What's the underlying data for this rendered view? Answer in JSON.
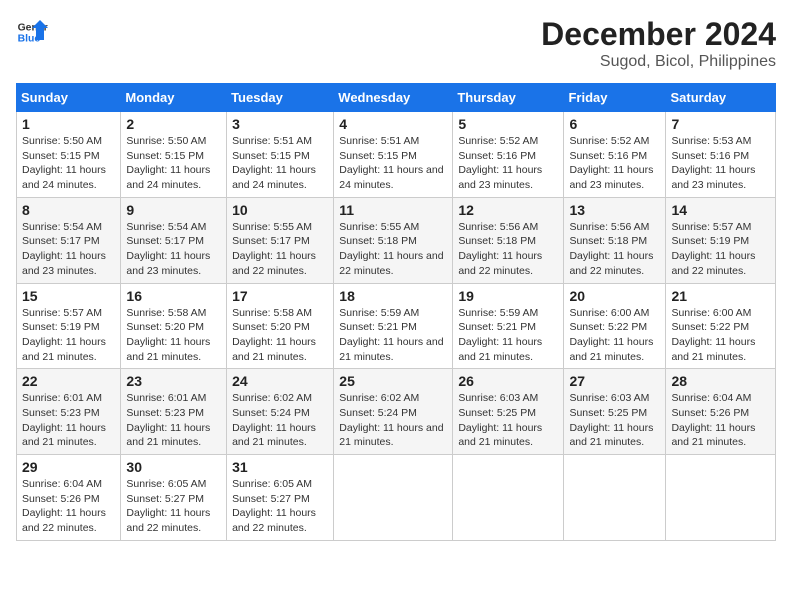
{
  "logo": {
    "line1": "General",
    "line2": "Blue"
  },
  "title": "December 2024",
  "subtitle": "Sugod, Bicol, Philippines",
  "headers": [
    "Sunday",
    "Monday",
    "Tuesday",
    "Wednesday",
    "Thursday",
    "Friday",
    "Saturday"
  ],
  "weeks": [
    [
      {
        "day": "1",
        "sunrise": "5:50 AM",
        "sunset": "5:15 PM",
        "daylight": "11 hours and 24 minutes."
      },
      {
        "day": "2",
        "sunrise": "5:50 AM",
        "sunset": "5:15 PM",
        "daylight": "11 hours and 24 minutes."
      },
      {
        "day": "3",
        "sunrise": "5:51 AM",
        "sunset": "5:15 PM",
        "daylight": "11 hours and 24 minutes."
      },
      {
        "day": "4",
        "sunrise": "5:51 AM",
        "sunset": "5:15 PM",
        "daylight": "11 hours and 24 minutes."
      },
      {
        "day": "5",
        "sunrise": "5:52 AM",
        "sunset": "5:16 PM",
        "daylight": "11 hours and 23 minutes."
      },
      {
        "day": "6",
        "sunrise": "5:52 AM",
        "sunset": "5:16 PM",
        "daylight": "11 hours and 23 minutes."
      },
      {
        "day": "7",
        "sunrise": "5:53 AM",
        "sunset": "5:16 PM",
        "daylight": "11 hours and 23 minutes."
      }
    ],
    [
      {
        "day": "8",
        "sunrise": "5:54 AM",
        "sunset": "5:17 PM",
        "daylight": "11 hours and 23 minutes."
      },
      {
        "day": "9",
        "sunrise": "5:54 AM",
        "sunset": "5:17 PM",
        "daylight": "11 hours and 23 minutes."
      },
      {
        "day": "10",
        "sunrise": "5:55 AM",
        "sunset": "5:17 PM",
        "daylight": "11 hours and 22 minutes."
      },
      {
        "day": "11",
        "sunrise": "5:55 AM",
        "sunset": "5:18 PM",
        "daylight": "11 hours and 22 minutes."
      },
      {
        "day": "12",
        "sunrise": "5:56 AM",
        "sunset": "5:18 PM",
        "daylight": "11 hours and 22 minutes."
      },
      {
        "day": "13",
        "sunrise": "5:56 AM",
        "sunset": "5:18 PM",
        "daylight": "11 hours and 22 minutes."
      },
      {
        "day": "14",
        "sunrise": "5:57 AM",
        "sunset": "5:19 PM",
        "daylight": "11 hours and 22 minutes."
      }
    ],
    [
      {
        "day": "15",
        "sunrise": "5:57 AM",
        "sunset": "5:19 PM",
        "daylight": "11 hours and 21 minutes."
      },
      {
        "day": "16",
        "sunrise": "5:58 AM",
        "sunset": "5:20 PM",
        "daylight": "11 hours and 21 minutes."
      },
      {
        "day": "17",
        "sunrise": "5:58 AM",
        "sunset": "5:20 PM",
        "daylight": "11 hours and 21 minutes."
      },
      {
        "day": "18",
        "sunrise": "5:59 AM",
        "sunset": "5:21 PM",
        "daylight": "11 hours and 21 minutes."
      },
      {
        "day": "19",
        "sunrise": "5:59 AM",
        "sunset": "5:21 PM",
        "daylight": "11 hours and 21 minutes."
      },
      {
        "day": "20",
        "sunrise": "6:00 AM",
        "sunset": "5:22 PM",
        "daylight": "11 hours and 21 minutes."
      },
      {
        "day": "21",
        "sunrise": "6:00 AM",
        "sunset": "5:22 PM",
        "daylight": "11 hours and 21 minutes."
      }
    ],
    [
      {
        "day": "22",
        "sunrise": "6:01 AM",
        "sunset": "5:23 PM",
        "daylight": "11 hours and 21 minutes."
      },
      {
        "day": "23",
        "sunrise": "6:01 AM",
        "sunset": "5:23 PM",
        "daylight": "11 hours and 21 minutes."
      },
      {
        "day": "24",
        "sunrise": "6:02 AM",
        "sunset": "5:24 PM",
        "daylight": "11 hours and 21 minutes."
      },
      {
        "day": "25",
        "sunrise": "6:02 AM",
        "sunset": "5:24 PM",
        "daylight": "11 hours and 21 minutes."
      },
      {
        "day": "26",
        "sunrise": "6:03 AM",
        "sunset": "5:25 PM",
        "daylight": "11 hours and 21 minutes."
      },
      {
        "day": "27",
        "sunrise": "6:03 AM",
        "sunset": "5:25 PM",
        "daylight": "11 hours and 21 minutes."
      },
      {
        "day": "28",
        "sunrise": "6:04 AM",
        "sunset": "5:26 PM",
        "daylight": "11 hours and 21 minutes."
      }
    ],
    [
      {
        "day": "29",
        "sunrise": "6:04 AM",
        "sunset": "5:26 PM",
        "daylight": "11 hours and 22 minutes."
      },
      {
        "day": "30",
        "sunrise": "6:05 AM",
        "sunset": "5:27 PM",
        "daylight": "11 hours and 22 minutes."
      },
      {
        "day": "31",
        "sunrise": "6:05 AM",
        "sunset": "5:27 PM",
        "daylight": "11 hours and 22 minutes."
      },
      null,
      null,
      null,
      null
    ]
  ],
  "labels": {
    "sunrise": "Sunrise:",
    "sunset": "Sunset:",
    "daylight": "Daylight:"
  }
}
